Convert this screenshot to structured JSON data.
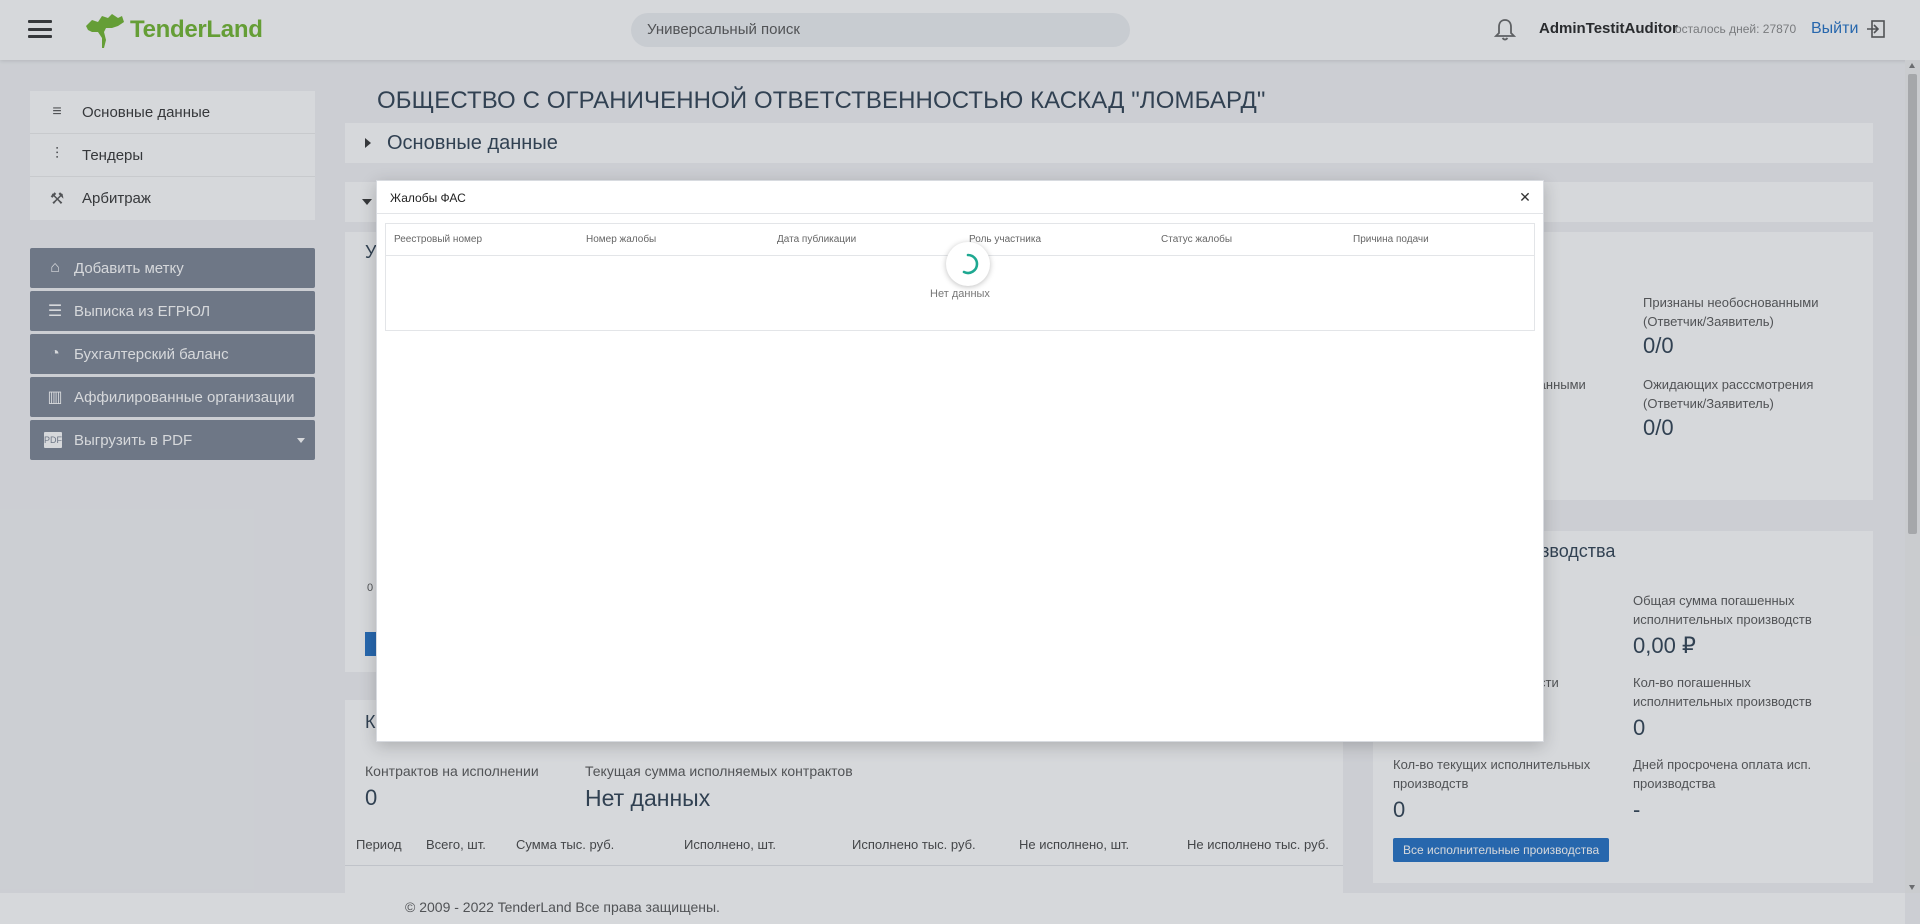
{
  "header": {
    "logo_text": "TenderLand",
    "search_placeholder": "Универсальный поиск",
    "username": "AdminTestitAuditor",
    "days_left": "осталось дней: 27870",
    "logout_label": "Выйти"
  },
  "sidebar": {
    "nav_items": [
      {
        "label": "Основные данные",
        "icon": "lines-icon"
      },
      {
        "label": "Тендеры",
        "icon": "sliders-icon"
      },
      {
        "label": "Арбитраж",
        "icon": "gavel-icon"
      }
    ],
    "actions": [
      {
        "label": "Добавить метку",
        "icon": "tag-icon"
      },
      {
        "label": "Выписка из ЕГРЮЛ",
        "icon": "list-check-icon"
      },
      {
        "label": "Бухгалтерский баланс",
        "icon": "pie-chart-icon"
      },
      {
        "label": "Аффилированные организации",
        "icon": "buildings-icon"
      },
      {
        "label": "Выгрузить в PDF",
        "icon": "pdf-icon"
      }
    ]
  },
  "main": {
    "company_title": "ОБЩЕСТВО С ОГРАНИЧЕННОЙ ОТВЕТСТВЕННОСТЬЮ КАСКАД \"ЛОМБАРД\"",
    "section_basic": "Основные данные",
    "left_card_partial_head": "У",
    "left_card_partial_value": "0",
    "contracts_partial_head": "К",
    "fas_stats": {
      "label_partial_1": "ми",
      "label_unfounded": "Признаны необоснованными (Ответчик/Заявитель)",
      "value_unfounded": "0/0",
      "label_partial_2": "снованными",
      "label_pending": "Ожидающих расссмотрения (Ответчик/Заявитель)",
      "value_pending": "0/0"
    },
    "enforcement": {
      "head_partial": "роизводства",
      "label_total_repaid": "Общая сумма погашенных исполнительных производств",
      "value_total_repaid": "0,00 ₽",
      "label_partial": "сти",
      "label_count_repaid": "Кол-во погашенных исполнительных производств",
      "value_count_repaid": "0",
      "label_current": "Кол-во текущих исполнительных производств",
      "value_current": "0",
      "label_overdue": "Дней просрочена оплата исп. производства",
      "value_overdue": "-",
      "all_button": "Все исполнительные производства"
    },
    "contracts": {
      "label_in_progress": "Контрактов на исполнении",
      "value_in_progress": "0",
      "label_current_sum": "Текущая сумма исполняемых контрактов",
      "value_current_sum": "Нет данных",
      "columns": [
        "Период",
        "Всего, шт.",
        "Сумма тыс. руб.",
        "Исполнено, шт.",
        "Исполнено тыс. руб.",
        "Не исполнено, шт.",
        "Не исполнено тыс. руб."
      ]
    }
  },
  "modal": {
    "title": "Жалобы ФАС",
    "columns": [
      "Реестровый номер",
      "Номер жалобы",
      "Дата публикации",
      "Роль участника",
      "Статус жалобы",
      "Причина подачи"
    ],
    "empty_text": "Нет данных"
  },
  "footer": {
    "copyright": "© 2009 - 2022 TenderLand Все права защищены."
  }
}
